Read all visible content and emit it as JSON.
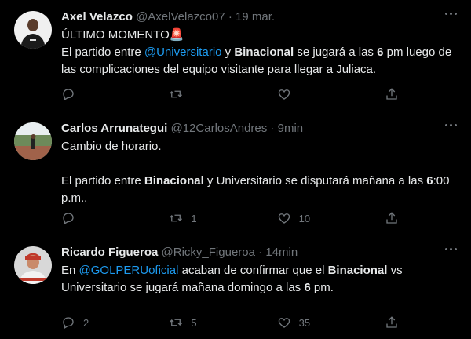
{
  "tweets": [
    {
      "name": "Axel Velazco",
      "handle": "@AxelVelazco07",
      "dot": "·",
      "time": "19 mar.",
      "line1": "ÚLTIMO MOMENTO",
      "alarm_emoji": "🚨",
      "p1": "El partido entre ",
      "mention": "@Universitario",
      "p2": " y ",
      "b1": "Binacional",
      "p3": " se jugará a las ",
      "b2": "6",
      "p4": " pm luego de las complicaciones del equipo visitante para llegar a Juliaca.",
      "reply_count": "",
      "retweet_count": "",
      "like_count": ""
    },
    {
      "name": "Carlos Arrunategui",
      "handle": "@12CarlosAndres",
      "dot": "·",
      "time": "9min",
      "line1": "Cambio de horario.",
      "p1": "El partido entre ",
      "b1": "Binacional",
      "p2": " y Universitario se disputará mañana a las ",
      "b2": "6",
      "p3": ":00 p.m..",
      "reply_count": "",
      "retweet_count": "1",
      "like_count": "10"
    },
    {
      "name": "Ricardo Figueroa",
      "handle": "@Ricky_Figueroa",
      "dot": "·",
      "time": "14min",
      "p0": "En ",
      "mention": "@GOLPERUoficial",
      "p1": " acaban de confirmar que el ",
      "b1": "Binacional",
      "p2": " vs Universitario se jugará mañana domingo a las ",
      "b2": "6",
      "p3": " pm.",
      "reply_count": "2",
      "retweet_count": "5",
      "like_count": "35"
    }
  ],
  "icons": [
    "reply-icon",
    "retweet-icon",
    "like-icon",
    "share-icon",
    "more-icon"
  ],
  "colors": {
    "background": "#000000",
    "text": "#e7e9ea",
    "muted": "#71767b",
    "link": "#1d9bf0",
    "divider": "#2f3336"
  }
}
